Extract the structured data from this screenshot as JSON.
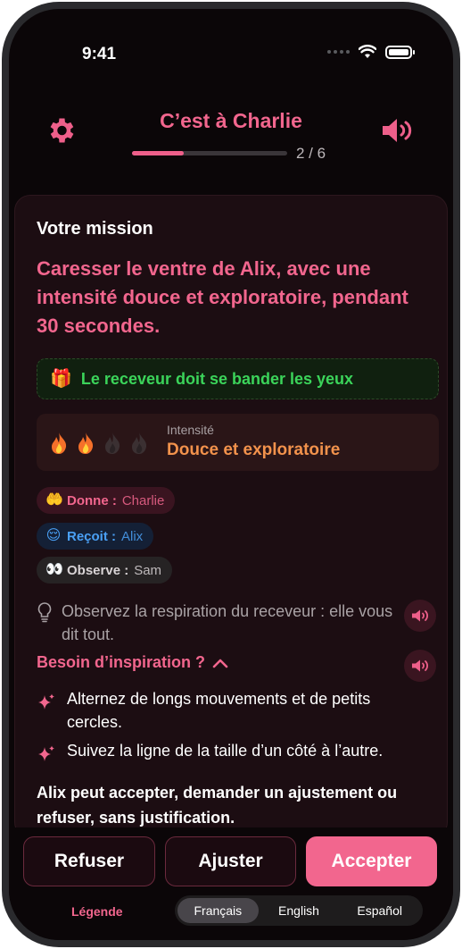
{
  "status_bar": {
    "time": "9:41"
  },
  "header": {
    "turn_title": "C’est à Charlie",
    "progress_label": "2 / 6",
    "progress_fraction": 0.333
  },
  "mission": {
    "heading": "Votre mission",
    "text": "Caresser le ventre de Alix, avec une intensité douce et exploratoire, pendant 30 secondes.",
    "blindfold": "Le receveur doit se bander les yeux",
    "intensity": {
      "caption": "Intensité",
      "value": "Douce et exploratoire",
      "level": 2,
      "max": 4
    },
    "roles": {
      "give": {
        "label": "Donne :",
        "name": "Charlie",
        "emoji": "🤲"
      },
      "receive": {
        "label": "Reçoit :",
        "name": "Alix",
        "emoji": "😌"
      },
      "observe": {
        "label": "Observe :",
        "name": "Sam",
        "emoji": "👀"
      }
    },
    "tip": "Observez la respiration du receveur : elle vous dit tout.",
    "inspiration": {
      "heading": "Besoin d’inspiration ?",
      "ideas": [
        "Alternez de longs mouvements et de petits cercles.",
        "Suivez la ligne de la taille d’un côté à l’autre."
      ]
    },
    "consent": "Alix peut accepter, demander un ajustement ou refuser, sans justification."
  },
  "actions": {
    "refuse": "Refuser",
    "adjust": "Ajuster",
    "accept": "Accepter"
  },
  "footer": {
    "legend": "Légende",
    "languages": [
      "Français",
      "English",
      "Español"
    ],
    "active_language": "Français"
  },
  "colors": {
    "accent": "#f2668e",
    "background": "#0b0608",
    "success": "#3bd45a",
    "intensity": "#f2924c",
    "receive": "#4aa0f5"
  }
}
